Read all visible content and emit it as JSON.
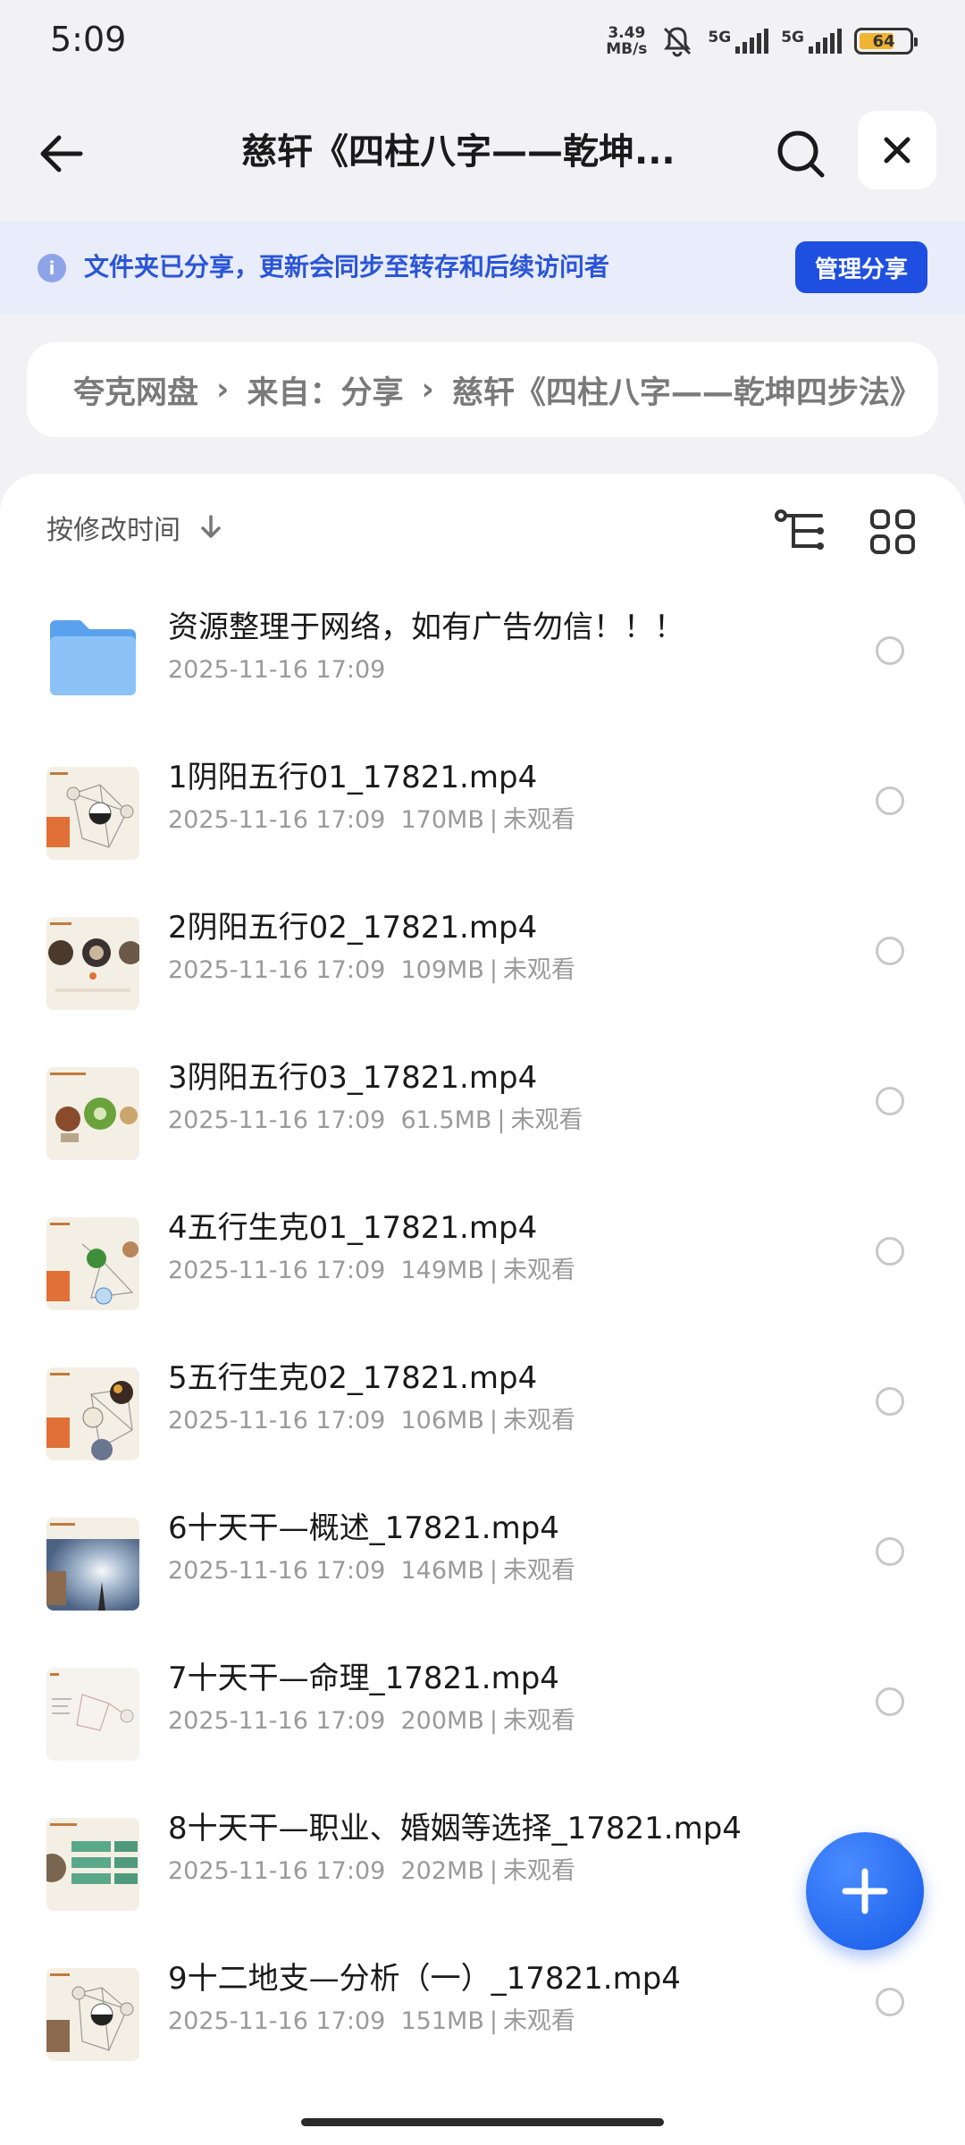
{
  "status": {
    "time": "5:09",
    "net_speed_value": "3.49",
    "net_speed_unit": "MB/s",
    "sim1": "5G",
    "sim2": "5G",
    "battery": "64"
  },
  "header": {
    "title": "慈轩《四柱八字——乾坤..."
  },
  "share_banner": {
    "text": "文件夹已分享，更新会同步至转存和后续访问者",
    "button": "管理分享"
  },
  "breadcrumb": [
    "夸克网盘",
    "来自：分享",
    "慈轩《四柱八字——乾坤四步法》"
  ],
  "toolbar": {
    "sort_label": "按修改时间"
  },
  "files": [
    {
      "name": "资源整理于网络，如有广告勿信！！！",
      "date": "2025-11-16 17:09",
      "size": "",
      "status": "",
      "type": "folder"
    },
    {
      "name": "1阴阳五行01_17821.mp4",
      "date": "2025-11-16 17:09",
      "size": "170MB",
      "status": "未观看",
      "type": "video"
    },
    {
      "name": "2阴阳五行02_17821.mp4",
      "date": "2025-11-16 17:09",
      "size": "109MB",
      "status": "未观看",
      "type": "video"
    },
    {
      "name": "3阴阳五行03_17821.mp4",
      "date": "2025-11-16 17:09",
      "size": "61.5MB",
      "status": "未观看",
      "type": "video"
    },
    {
      "name": "4五行生克01_17821.mp4",
      "date": "2025-11-16 17:09",
      "size": "149MB",
      "status": "未观看",
      "type": "video"
    },
    {
      "name": "5五行生克02_17821.mp4",
      "date": "2025-11-16 17:09",
      "size": "106MB",
      "status": "未观看",
      "type": "video"
    },
    {
      "name": "6十天干—概述_17821.mp4",
      "date": "2025-11-16 17:09",
      "size": "146MB",
      "status": "未观看",
      "type": "video"
    },
    {
      "name": "7十天干—命理_17821.mp4",
      "date": "2025-11-16 17:09",
      "size": "200MB",
      "status": "未观看",
      "type": "video"
    },
    {
      "name": "8十天干—职业、婚姻等选择_17821.mp4",
      "date": "2025-11-16 17:09",
      "size": "202MB",
      "status": "未观看",
      "type": "video"
    },
    {
      "name": "9十二地支—分析（一）_17821.mp4",
      "date": "2025-11-16 17:09",
      "size": "151MB",
      "status": "未观看",
      "type": "video"
    }
  ],
  "icons": {
    "back": "arrow-left-icon",
    "search": "search-icon",
    "close": "close-icon",
    "info": "info-icon",
    "sort": "arrow-down-icon",
    "tree": "tree-view-icon",
    "grid": "grid-view-icon",
    "add": "plus-icon"
  },
  "colors": {
    "accent": "#1f4fe0",
    "banner_bg": "#e8ecfb",
    "banner_text": "#2a55d8"
  }
}
